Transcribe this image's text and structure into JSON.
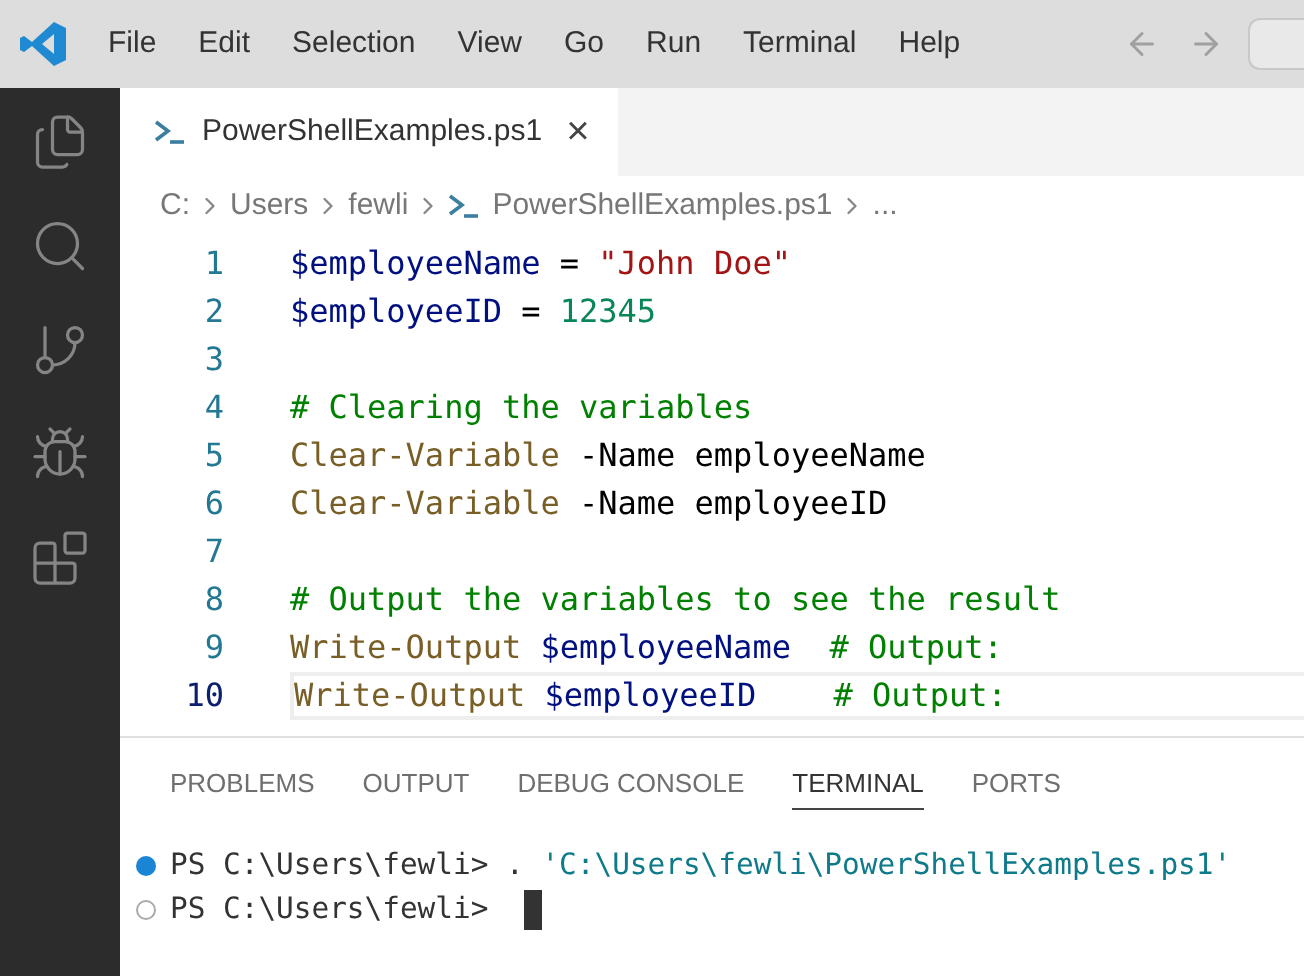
{
  "menu": [
    "File",
    "Edit",
    "Selection",
    "View",
    "Go",
    "Run",
    "Terminal",
    "Help"
  ],
  "tabs": [
    {
      "label": "PowerShellExamples.ps1",
      "selected": true,
      "close": "×"
    }
  ],
  "breadcrumb": [
    {
      "label": "C:",
      "kind": "text"
    },
    {
      "label": "Users",
      "kind": "text"
    },
    {
      "label": "fewli",
      "kind": "text"
    },
    {
      "label": "PowerShellExamples.ps1",
      "kind": "file"
    },
    {
      "label": "...",
      "kind": "text"
    }
  ],
  "code_lines": [
    {
      "number": "1",
      "current": false,
      "tokens": [
        {
          "text": "$employeeName",
          "kind": "variable"
        },
        {
          "text": " = ",
          "kind": "plain"
        },
        {
          "text": "\"John Doe\"",
          "kind": "string"
        }
      ]
    },
    {
      "number": "2",
      "current": false,
      "tokens": [
        {
          "text": "$employeeID",
          "kind": "variable"
        },
        {
          "text": " = ",
          "kind": "plain"
        },
        {
          "text": "12345",
          "kind": "number"
        }
      ]
    },
    {
      "number": "3",
      "current": false
    },
    {
      "number": "4",
      "current": false,
      "tokens": [
        {
          "text": "# Clearing the variables",
          "kind": "comment"
        }
      ]
    },
    {
      "number": "5",
      "current": false,
      "tokens": [
        {
          "text": "Clear-Variable",
          "kind": "command"
        },
        {
          "text": " -Name employeeName",
          "kind": "plain"
        }
      ]
    },
    {
      "number": "6",
      "current": false,
      "tokens": [
        {
          "text": "Clear-Variable",
          "kind": "command"
        },
        {
          "text": " -Name employeeID",
          "kind": "plain"
        }
      ]
    },
    {
      "number": "7",
      "current": false
    },
    {
      "number": "8",
      "current": false,
      "tokens": [
        {
          "text": "# Output the variables to see the result",
          "kind": "comment"
        }
      ]
    },
    {
      "number": "9",
      "current": false,
      "tokens": [
        {
          "text": "Write-Output",
          "kind": "command"
        },
        {
          "text": " $employeeName",
          "kind": "variable"
        },
        {
          "text": "  # Output:",
          "kind": "comment"
        }
      ]
    },
    {
      "number": "10",
      "current": true,
      "tokens": [
        {
          "text": "Write-Output",
          "kind": "command"
        },
        {
          "text": " $employeeID",
          "kind": "variable"
        },
        {
          "text": "    # Output:",
          "kind": "comment"
        }
      ]
    }
  ],
  "panel_tabs": [
    {
      "label": "PROBLEMS",
      "selected": false
    },
    {
      "label": "OUTPUT",
      "selected": false
    },
    {
      "label": "DEBUG CONSOLE",
      "selected": false
    },
    {
      "label": "TERMINAL",
      "selected": true
    },
    {
      "label": "PORTS",
      "selected": false
    }
  ],
  "terminal_lines": [
    {
      "succeeded": true,
      "prompt": "PS C:\\Users\\fewli>",
      "command": ". ",
      "argument": "'C:\\Users\\fewli\\PowerShellExamples.ps1'",
      "cursor": false
    },
    {
      "succeeded": false,
      "prompt": "PS C:\\Users\\fewli>",
      "cursor": true
    }
  ]
}
